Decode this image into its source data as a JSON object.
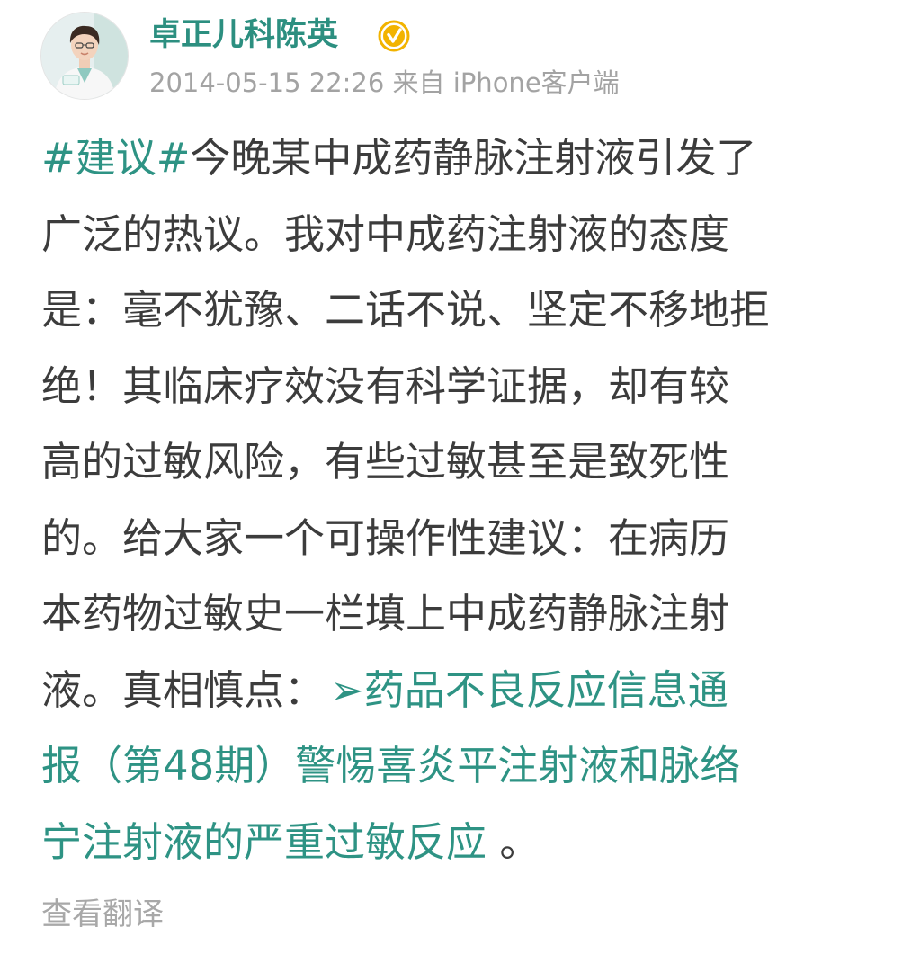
{
  "author": {
    "name": "卓正儿科陈英",
    "verified_icon": "verified-badge-icon",
    "avatar_icon": "doctor-avatar-icon"
  },
  "meta": {
    "timestamp": "2014-05-15 22:26",
    "source": "来自 iPhone客户端"
  },
  "post": {
    "lines": [
      "今晚某中成药静脉注射液引发了",
      "广泛的热议。我对中成药注射液的态度",
      "是：毫不犹豫、二话不说、坚定不移地拒",
      "绝！其临床疗效没有科学证据，却有较",
      "高的过敏风险，有些过敏甚至是致死性",
      "的。给大家一个可操作性建议：在病历",
      "本药物过敏史一栏填上中成药静脉注射"
    ],
    "hashtag": "#建议#",
    "lead_in": "液。真相慎点：",
    "link_arrow": "➢",
    "link_lines": [
      "药品不良反应信息通",
      "报（第48期）警惕喜炎平注射液和脉络",
      "宁注射液的严重过敏反应"
    ],
    "end_punct": " 。"
  },
  "actions": {
    "translate_label": "查看翻译"
  },
  "colors": {
    "accent": "#2e9384",
    "text": "#3c3c3c",
    "muted": "#a3a3a3",
    "verified": "#f2b300"
  }
}
